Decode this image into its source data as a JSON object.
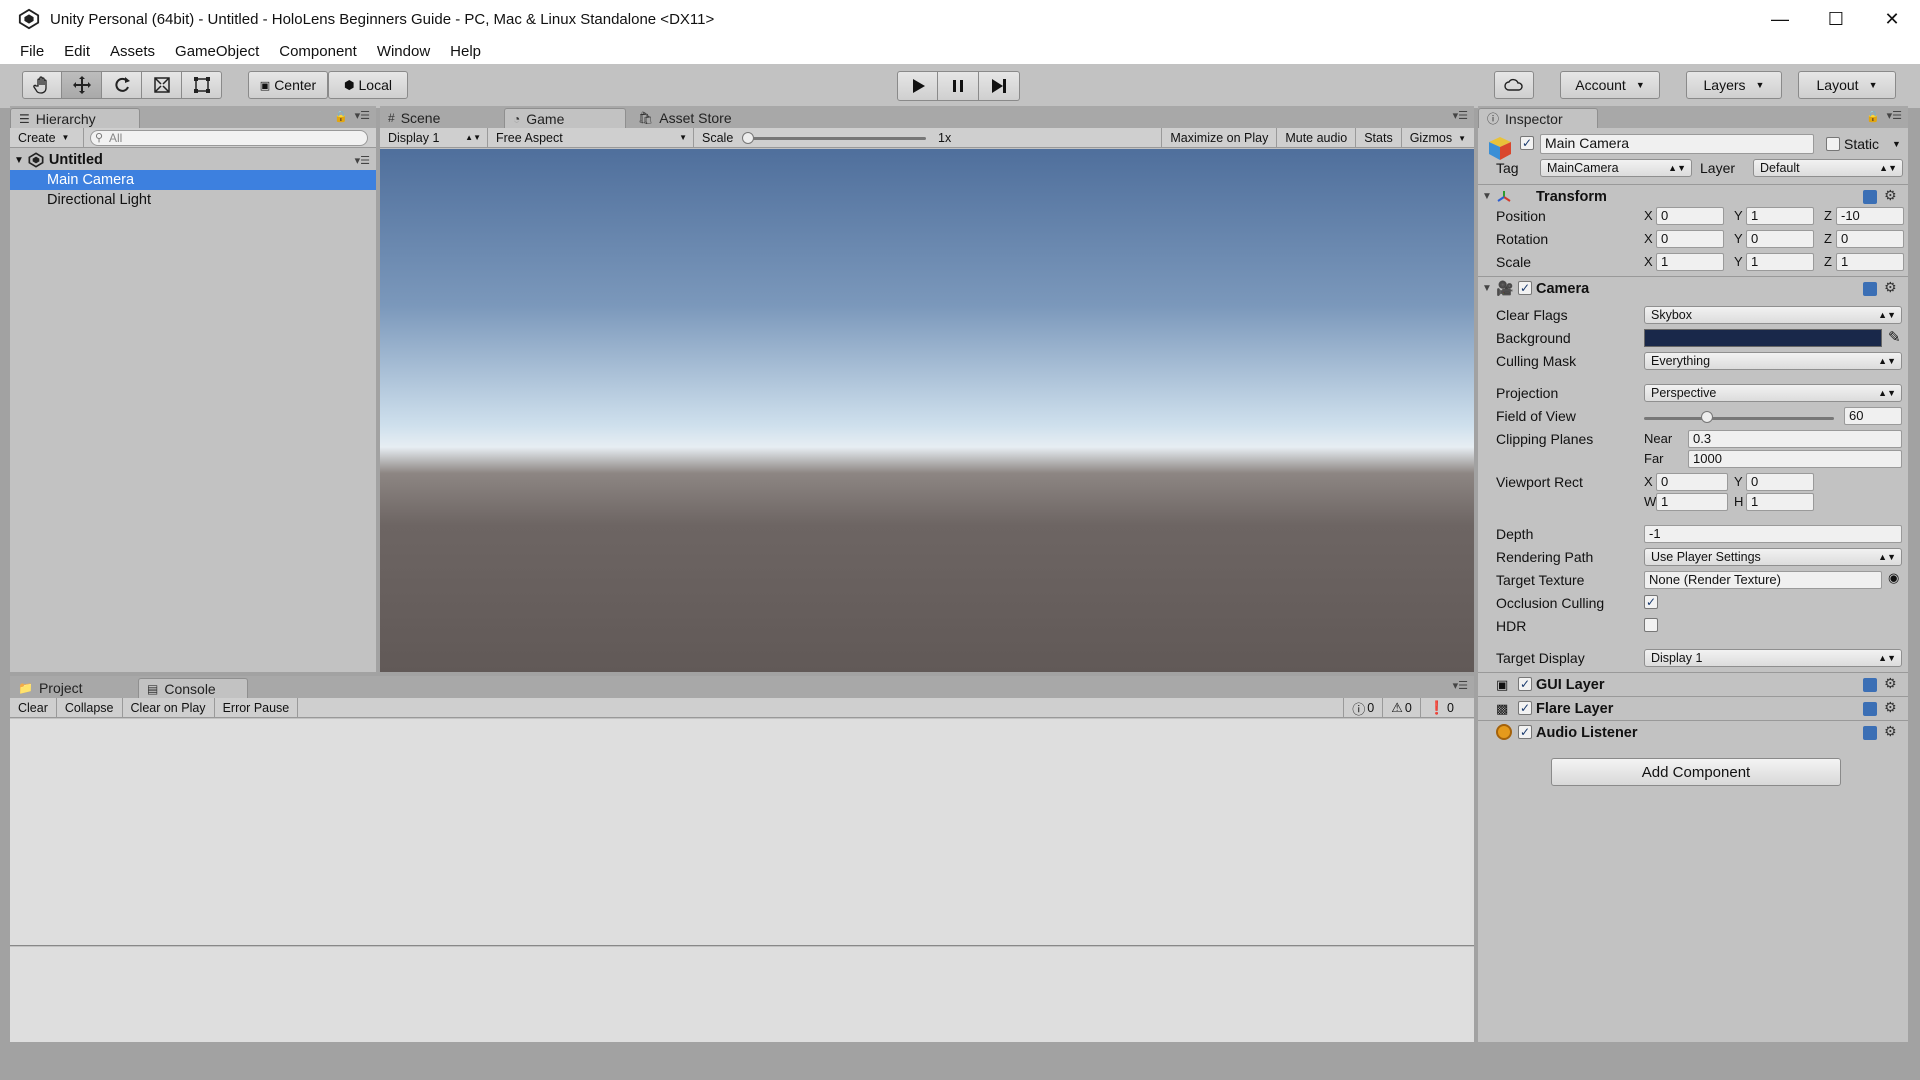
{
  "window": {
    "title": "Unity Personal (64bit) - Untitled - HoloLens Beginners Guide - PC, Mac & Linux Standalone <DX11>"
  },
  "menu": [
    "File",
    "Edit",
    "Assets",
    "GameObject",
    "Component",
    "Window",
    "Help"
  ],
  "toolbar": {
    "pivot": "Center",
    "space": "Local",
    "account": "Account",
    "layers": "Layers",
    "layout": "Layout"
  },
  "hierarchy": {
    "tab": "Hierarchy",
    "create": "Create",
    "search_placeholder": "All",
    "scene": "Untitled",
    "items": [
      "Main Camera",
      "Directional Light"
    ]
  },
  "game": {
    "tabs": [
      "Scene",
      "Game",
      "Asset Store"
    ],
    "display": "Display 1",
    "aspect": "Free Aspect",
    "scale_label": "Scale",
    "scale_value": "1x",
    "scale_fraction": 0.0,
    "buttons": [
      "Maximize on Play",
      "Mute audio",
      "Stats",
      "Gizmos"
    ]
  },
  "console": {
    "tabs": [
      "Project",
      "Console"
    ],
    "buttons": [
      "Clear",
      "Collapse",
      "Clear on Play",
      "Error Pause"
    ],
    "counts": {
      "info": "0",
      "warning": "0",
      "error": "0"
    }
  },
  "inspector": {
    "tab": "Inspector",
    "object_name": "Main Camera",
    "static_label": "Static",
    "tag_label": "Tag",
    "tag": "MainCamera",
    "layer_label": "Layer",
    "layer": "Default",
    "transform": {
      "title": "Transform",
      "position_label": "Position",
      "position": {
        "x": "0",
        "y": "1",
        "z": "-10"
      },
      "rotation_label": "Rotation",
      "rotation": {
        "x": "0",
        "y": "0",
        "z": "0"
      },
      "scale_label": "Scale",
      "scale": {
        "x": "1",
        "y": "1",
        "z": "1"
      }
    },
    "camera": {
      "title": "Camera",
      "clear_flags_label": "Clear Flags",
      "clear_flags": "Skybox",
      "background_label": "Background",
      "background_color": "#19284a",
      "culling_mask_label": "Culling Mask",
      "culling_mask": "Everything",
      "projection_label": "Projection",
      "projection": "Perspective",
      "fov_label": "Field of View",
      "fov": "60",
      "fov_fraction": 0.33,
      "clipping_label": "Clipping Planes",
      "near_label": "Near",
      "near": "0.3",
      "far_label": "Far",
      "far": "1000",
      "viewport_label": "Viewport Rect",
      "vx": "0",
      "vy": "0",
      "vw": "1",
      "vh": "1",
      "depth_label": "Depth",
      "depth": "-1",
      "rendering_path_label": "Rendering Path",
      "rendering_path": "Use Player Settings",
      "target_texture_label": "Target Texture",
      "target_texture": "None (Render Texture)",
      "occlusion_label": "Occlusion Culling",
      "occlusion": true,
      "hdr_label": "HDR",
      "hdr": false,
      "target_display_label": "Target Display",
      "target_display": "Display 1"
    },
    "components": [
      "GUI Layer",
      "Flare Layer",
      "Audio Listener"
    ],
    "add_component": "Add Component"
  }
}
